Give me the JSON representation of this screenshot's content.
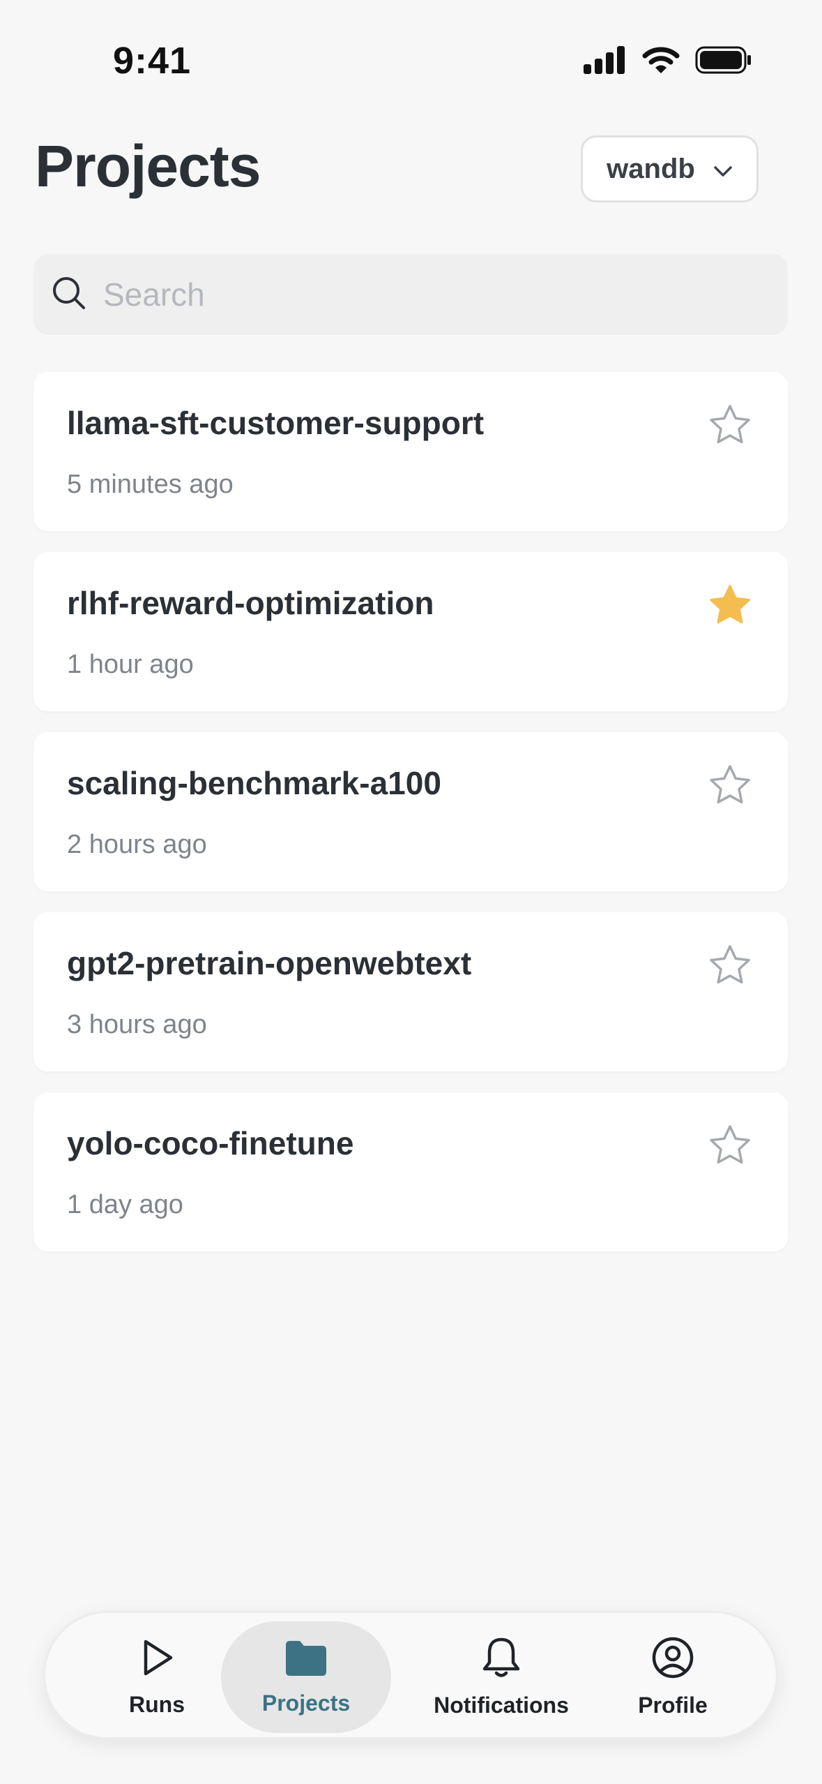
{
  "status_bar": {
    "time": "9:41"
  },
  "header": {
    "title": "Projects",
    "org_selector": "wandb"
  },
  "search": {
    "placeholder": "Search"
  },
  "projects": [
    {
      "name": "llama-sft-customer-support",
      "updated": "5 minutes ago",
      "starred": false
    },
    {
      "name": "rlhf-reward-optimization",
      "updated": "1 hour ago",
      "starred": true
    },
    {
      "name": "scaling-benchmark-a100",
      "updated": "2 hours ago",
      "starred": false
    },
    {
      "name": "gpt2-pretrain-openwebtext",
      "updated": "3 hours ago",
      "starred": false
    },
    {
      "name": "yolo-coco-finetune",
      "updated": "1 day ago",
      "starred": false
    }
  ],
  "tab_bar": {
    "tabs": [
      {
        "label": "Runs",
        "icon": "play-icon",
        "active": false
      },
      {
        "label": "Projects",
        "icon": "folder-icon",
        "active": true
      },
      {
        "label": "Notifications",
        "icon": "bell-icon",
        "active": false
      },
      {
        "label": "Profile",
        "icon": "user-circle-icon",
        "active": false
      }
    ]
  },
  "colors": {
    "accent": "#3c7284",
    "star_filled": "#f4bd4f",
    "star_outline": "#a5a9ae",
    "background": "#f7f7f7"
  }
}
